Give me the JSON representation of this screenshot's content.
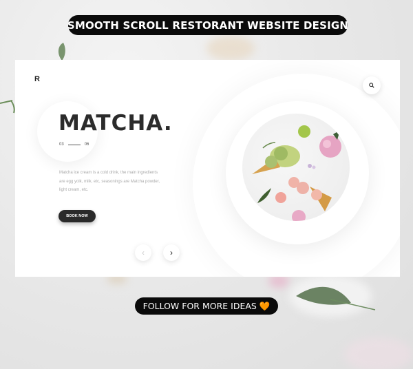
{
  "banner": {
    "top_text": "SMOOTH SCROLL RESTORANT WEBSITE DESIGN",
    "bottom_text": "FOLLOW FOR MORE IDEAS",
    "heart": "🧡"
  },
  "site": {
    "logo": "R",
    "title": "MATCHA.",
    "counter_current": "03",
    "counter_total": "06",
    "description": "Matcha ice cream is a cold drink, the main ingredients are egg yolk, milk, etc, seasonings are Matcha powder, light cream, etc.",
    "book_button": "BOOK NOW",
    "nav_prev": "‹",
    "nav_next": "›"
  },
  "icons": [
    "search-icon",
    "chevron-left-icon",
    "chevron-right-icon"
  ],
  "colors": {
    "accent": "#2b2b2b",
    "background": "#ffffff",
    "pill": "#0b0b0b"
  }
}
